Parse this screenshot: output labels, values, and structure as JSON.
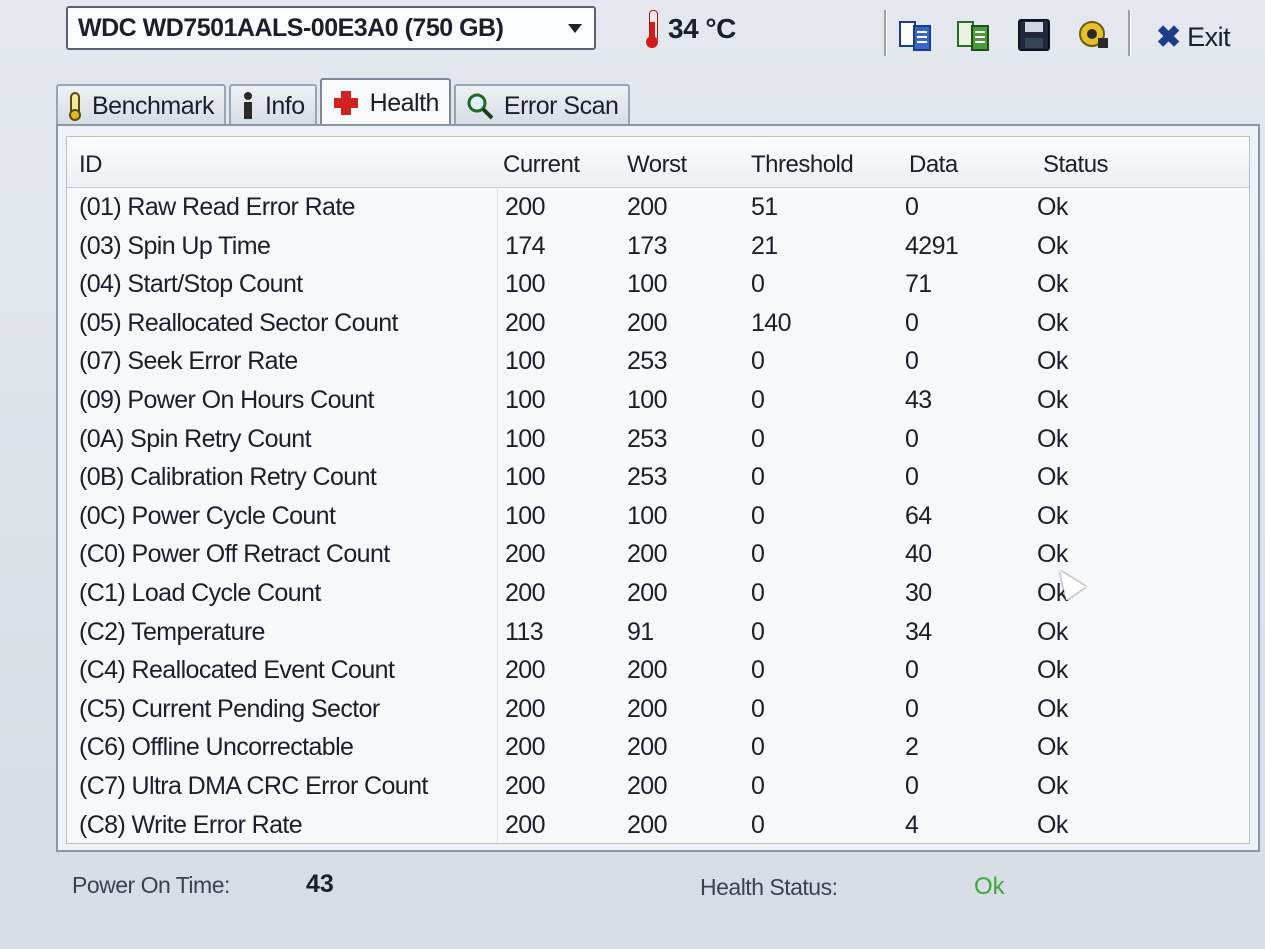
{
  "toolbar": {
    "drive": "WDC WD7501AALS-00E3A0 (750 GB)",
    "temperature": "34 °C",
    "exit_label": "Exit"
  },
  "tabs": [
    {
      "label": "Benchmark",
      "icon": "benchmark-icon"
    },
    {
      "label": "Info",
      "icon": "info-icon"
    },
    {
      "label": "Health",
      "icon": "health-cross-icon",
      "active": true
    },
    {
      "label": "Error Scan",
      "icon": "magnifier-icon"
    }
  ],
  "table": {
    "headers": {
      "id": "ID",
      "current": "Current",
      "worst": "Worst",
      "threshold": "Threshold",
      "data": "Data",
      "status": "Status"
    },
    "rows": [
      {
        "id": "(01) Raw Read Error Rate",
        "current": "200",
        "worst": "200",
        "threshold": "51",
        "data": "0",
        "status": "Ok"
      },
      {
        "id": "(03) Spin Up Time",
        "current": "174",
        "worst": "173",
        "threshold": "21",
        "data": "4291",
        "status": "Ok"
      },
      {
        "id": "(04) Start/Stop Count",
        "current": "100",
        "worst": "100",
        "threshold": "0",
        "data": "71",
        "status": "Ok"
      },
      {
        "id": "(05) Reallocated Sector Count",
        "current": "200",
        "worst": "200",
        "threshold": "140",
        "data": "0",
        "status": "Ok"
      },
      {
        "id": "(07) Seek Error Rate",
        "current": "100",
        "worst": "253",
        "threshold": "0",
        "data": "0",
        "status": "Ok"
      },
      {
        "id": "(09) Power On Hours Count",
        "current": "100",
        "worst": "100",
        "threshold": "0",
        "data": "43",
        "status": "Ok"
      },
      {
        "id": "(0A) Spin Retry Count",
        "current": "100",
        "worst": "253",
        "threshold": "0",
        "data": "0",
        "status": "Ok"
      },
      {
        "id": "(0B) Calibration Retry Count",
        "current": "100",
        "worst": "253",
        "threshold": "0",
        "data": "0",
        "status": "Ok"
      },
      {
        "id": "(0C) Power Cycle Count",
        "current": "100",
        "worst": "100",
        "threshold": "0",
        "data": "64",
        "status": "Ok"
      },
      {
        "id": "(C0) Power Off Retract Count",
        "current": "200",
        "worst": "200",
        "threshold": "0",
        "data": "40",
        "status": "Ok"
      },
      {
        "id": "(C1) Load Cycle Count",
        "current": "200",
        "worst": "200",
        "threshold": "0",
        "data": "30",
        "status": "Ok"
      },
      {
        "id": "(C2) Temperature",
        "current": "113",
        "worst": "91",
        "threshold": "0",
        "data": "34",
        "status": "Ok"
      },
      {
        "id": "(C4) Reallocated Event Count",
        "current": "200",
        "worst": "200",
        "threshold": "0",
        "data": "0",
        "status": "Ok"
      },
      {
        "id": "(C5) Current Pending Sector",
        "current": "200",
        "worst": "200",
        "threshold": "0",
        "data": "0",
        "status": "Ok"
      },
      {
        "id": "(C6) Offline Uncorrectable",
        "current": "200",
        "worst": "200",
        "threshold": "0",
        "data": "2",
        "status": "Ok"
      },
      {
        "id": "(C7) Ultra DMA CRC Error Count",
        "current": "200",
        "worst": "200",
        "threshold": "0",
        "data": "0",
        "status": "Ok"
      },
      {
        "id": "(C8) Write Error Rate",
        "current": "200",
        "worst": "200",
        "threshold": "0",
        "data": "4",
        "status": "Ok"
      }
    ]
  },
  "footer": {
    "power_on_label": "Power On Time:",
    "power_on_value": "43",
    "health_label": "Health Status:",
    "health_value": "Ok"
  }
}
